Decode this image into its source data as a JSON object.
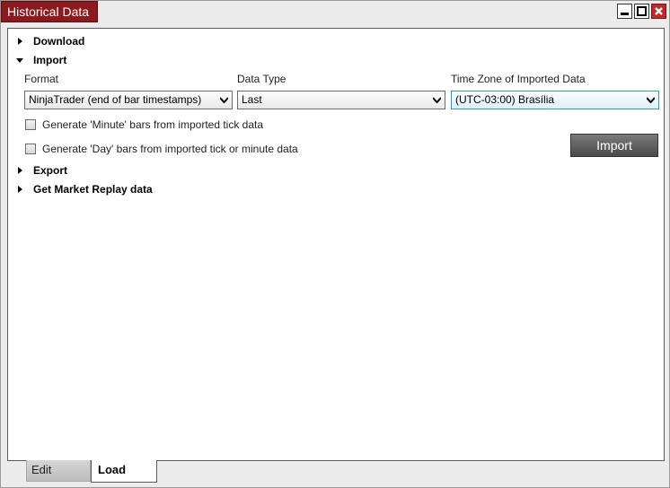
{
  "window": {
    "title": "Historical Data",
    "controls": [
      "minimize-icon",
      "maximize-icon",
      "close-icon"
    ]
  },
  "sections": {
    "download": "Download",
    "import": "Import",
    "export": "Export",
    "market_replay": "Get Market Replay data"
  },
  "import_panel": {
    "format_label": "Format",
    "format_value": "NinjaTrader (end of bar timestamps)",
    "data_type_label": "Data Type",
    "data_type_value": "Last",
    "time_zone_label": "Time Zone of Imported Data",
    "time_zone_value": "(UTC-03:00) Brasília",
    "minute_bars_label": "Generate 'Minute' bars from imported tick data",
    "minute_bars_checked": false,
    "day_bars_label": "Generate 'Day' bars from imported tick or minute data",
    "day_bars_checked": false,
    "import_button": "Import"
  },
  "tabs": {
    "edit": "Edit",
    "load": "Load",
    "active": "Load"
  },
  "colors": {
    "title_bg": "#8b1a1f",
    "close_btn": "#c0282e",
    "focus_border": "#3399cc",
    "import_button": "#5a5a5a"
  }
}
